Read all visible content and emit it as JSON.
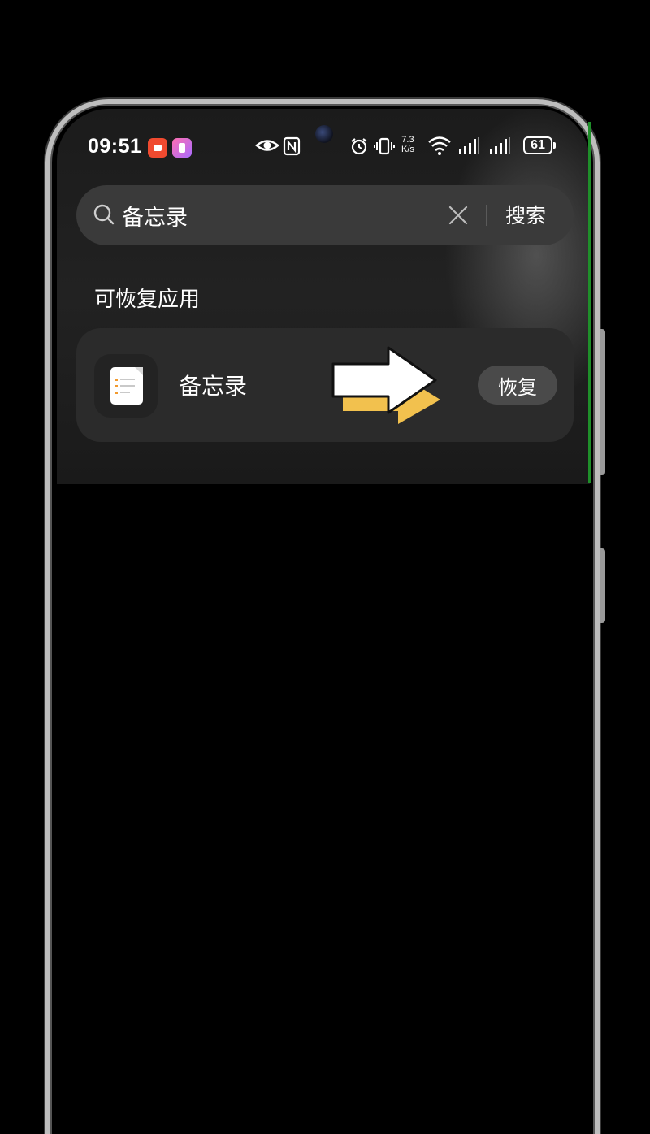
{
  "status_bar": {
    "time": "09:51",
    "network_speed_top": "7.3",
    "network_speed_bottom": "K/s",
    "battery_level": "61"
  },
  "search": {
    "query": "备忘录",
    "button_label": "搜索"
  },
  "section": {
    "title": "可恢复应用"
  },
  "results": [
    {
      "app_name": "备忘录",
      "action_label": "恢复"
    }
  ],
  "colors": {
    "background": "#000000",
    "row_bg": "#2b2b2b",
    "search_bg": "#3a3a3a",
    "arrow_fill": "#ffffff",
    "arrow_shadow": "#f2c14e",
    "note_check": "#f29a2e"
  },
  "icons": [
    "search-icon",
    "clear-icon",
    "notes-app-icon",
    "eye-icon",
    "nfc-icon",
    "alarm-icon",
    "vibrate-icon",
    "wifi-icon",
    "signal-icon",
    "battery-icon",
    "arrow-pointer-icon"
  ]
}
